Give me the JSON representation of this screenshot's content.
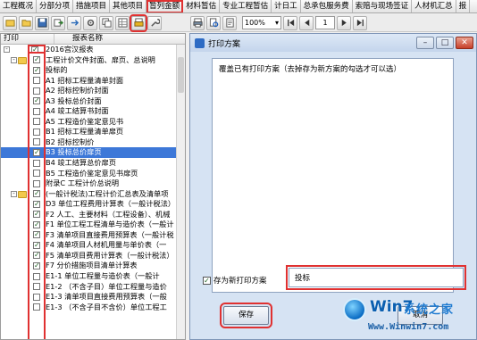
{
  "tabs": [
    "工程概况",
    "分部分项",
    "措施项目",
    "其他项目",
    "暂列金额",
    "材料暂估",
    "专业工程暂估",
    "计日工",
    "总承包服务费",
    "索赔与现场签证",
    "人材机汇总",
    "报"
  ],
  "toolbar": {
    "left_icons": [
      "open-icon",
      "folder-icon",
      "save-icon",
      "export-icon",
      "arrow-right-icon",
      "settings-icon",
      "copy-icon",
      "grid-icon",
      "print-scheme-icon",
      "wrench-icon"
    ],
    "right_icons": [
      "print-icon",
      "preview-icon",
      "page-setup-icon",
      "first-page-icon",
      "prev-page-icon"
    ],
    "zoom": "100%",
    "page_number": "1"
  },
  "tree": {
    "col_print": "打印",
    "col_name": "报表名称",
    "rows": [
      {
        "label": "2016宫汉报表",
        "checked": true,
        "level": 0,
        "expander": "-"
      },
      {
        "label": "工程计价文件封面、扉页、总说明",
        "checked": true,
        "level": 1,
        "expander": "-",
        "folder": true
      },
      {
        "label": "投标的",
        "checked": true,
        "level": 2
      },
      {
        "label": "A1  招标工程量清单封面",
        "checked": false,
        "level": 2
      },
      {
        "label": "A2  招标控制价封面",
        "checked": false,
        "level": 2
      },
      {
        "label": "A3  投标总价封面",
        "checked": true,
        "level": 2
      },
      {
        "label": "A4  竣工结算书封面",
        "checked": false,
        "level": 2
      },
      {
        "label": "A5  工程造价鉴定意见书",
        "checked": false,
        "level": 2
      },
      {
        "label": "B1  招标工程量清单扉页",
        "checked": false,
        "level": 2
      },
      {
        "label": "B2  招标控制价",
        "checked": false,
        "level": 2
      },
      {
        "label": "B3  投标总价扉页",
        "checked": true,
        "level": 2,
        "selected": true
      },
      {
        "label": "B4  竣工结算总价扉页",
        "checked": false,
        "level": 2
      },
      {
        "label": "B5  工程造价鉴定意见书扉页",
        "checked": false,
        "level": 2
      },
      {
        "label": "附录C  工程计价总说明",
        "checked": false,
        "level": 2
      },
      {
        "label": "(一般计税法)工程计价汇总表及清单项",
        "checked": true,
        "level": 1,
        "expander": "-",
        "folder": true
      },
      {
        "label": "D3  单位工程费用计算表（一般计税法）",
        "checked": true,
        "level": 2
      },
      {
        "label": "F2  人工、主要材料（工程设备）、机械",
        "checked": true,
        "level": 2
      },
      {
        "label": "F1  单位工程工程清单与造价表（一般计",
        "checked": true,
        "level": 2
      },
      {
        "label": "F3  清单项目直接费用预算表（一般计税",
        "checked": true,
        "level": 2
      },
      {
        "label": "F4  清单项目人材机用量与单价表（一",
        "checked": true,
        "level": 2
      },
      {
        "label": "F5  清单项目费用计算表（一般计税法）",
        "checked": true,
        "level": 2
      },
      {
        "label": "F7  分价措施项目清单计算表",
        "checked": true,
        "level": 2
      },
      {
        "label": "E1-1  单位工程量与造价表（一般计",
        "checked": false,
        "level": 2
      },
      {
        "label": "E1-2  （不含子目）单位工程量与造价",
        "checked": false,
        "level": 2
      },
      {
        "label": "E1-3  清单项目直接费用预算表（一般",
        "checked": false,
        "level": 2
      },
      {
        "label": "E1-3  （不含子目不含价）单位工程工",
        "checked": false,
        "level": 2
      }
    ]
  },
  "dialog": {
    "title": "打印方案",
    "list_hint": "覆盖已有打印方案（去掉存为新方案的勾选才可以选）",
    "save_as_label": "存为新打印方案",
    "save_as_checked": true,
    "scheme_name": "投标",
    "save_button": "保存",
    "cancel_button": "取消"
  },
  "watermark": {
    "brand": "Win7",
    "brand_suffix": "系统之家",
    "url": "Www.Winwin7.com"
  }
}
